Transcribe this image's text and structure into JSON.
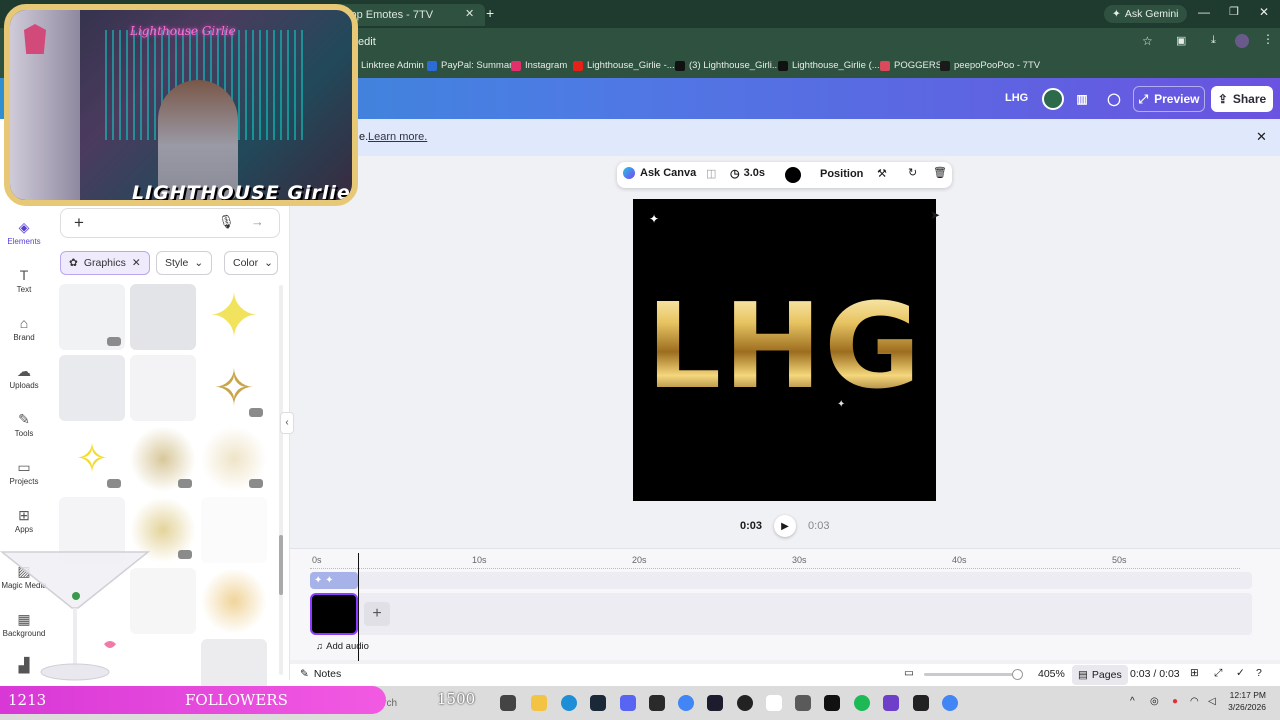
{
  "browser": {
    "tab_title": "Top Emotes - 7TV",
    "ask_gemini": "Ask Gemini",
    "url": "/edit",
    "bookmarks": [
      "Linktree Admin",
      "PayPal: Summary",
      "Instagram",
      "Lighthouse_Girlie -...",
      "(3) Lighthouse_Girli...",
      "Lighthouse_Girlie (...",
      "POGGERS",
      "peepoPooPoo - 7TV"
    ]
  },
  "canva_header": {
    "title": "LHG",
    "preview_label": "Preview",
    "share_label": "Share"
  },
  "banner": {
    "text_suffix": "e.",
    "link": "Learn more."
  },
  "left_nav": {
    "items": [
      "Te",
      "Elements",
      "Text",
      "Brand",
      "Uploads",
      "Tools",
      "Projects",
      "Apps",
      "Magic Media",
      "Background"
    ]
  },
  "panel": {
    "filter_graphics": "Graphics",
    "filter_style": "Style",
    "filter_color": "Color"
  },
  "toolbar": {
    "ask_canva": "Ask Canva",
    "duration": "3.0s",
    "position": "Position"
  },
  "design": {
    "text": "LHG"
  },
  "player": {
    "current": "0:03",
    "total": "0:03"
  },
  "timeline": {
    "ticks": [
      "0s",
      "10s",
      "20s",
      "30s",
      "40s",
      "50s"
    ],
    "add_audio": "Add audio"
  },
  "bottom_bar": {
    "notes": "Notes",
    "zoom": "405%",
    "pages": "Pages",
    "time": "0:03 / 0:03"
  },
  "overlay": {
    "followers_count": "1213",
    "followers_label": "FOLLOWERS",
    "followers_goal": "1500",
    "cam_title": "Lighthouse Girlie",
    "cam_logo": "LIGHTHOUSE Girlie"
  },
  "taskbar": {
    "search_placeholder": "earch",
    "time": "12:17 PM",
    "date": "3/26/2026"
  },
  "colors": {
    "tabbar": "#1f3a2e",
    "canva_gradient_start": "#2f8fd1",
    "canva_gradient_end": "#6a53e0",
    "canva_accent": "#8b3dff",
    "followers_bar": "#e04bdc",
    "gold": "#d8b04a"
  }
}
